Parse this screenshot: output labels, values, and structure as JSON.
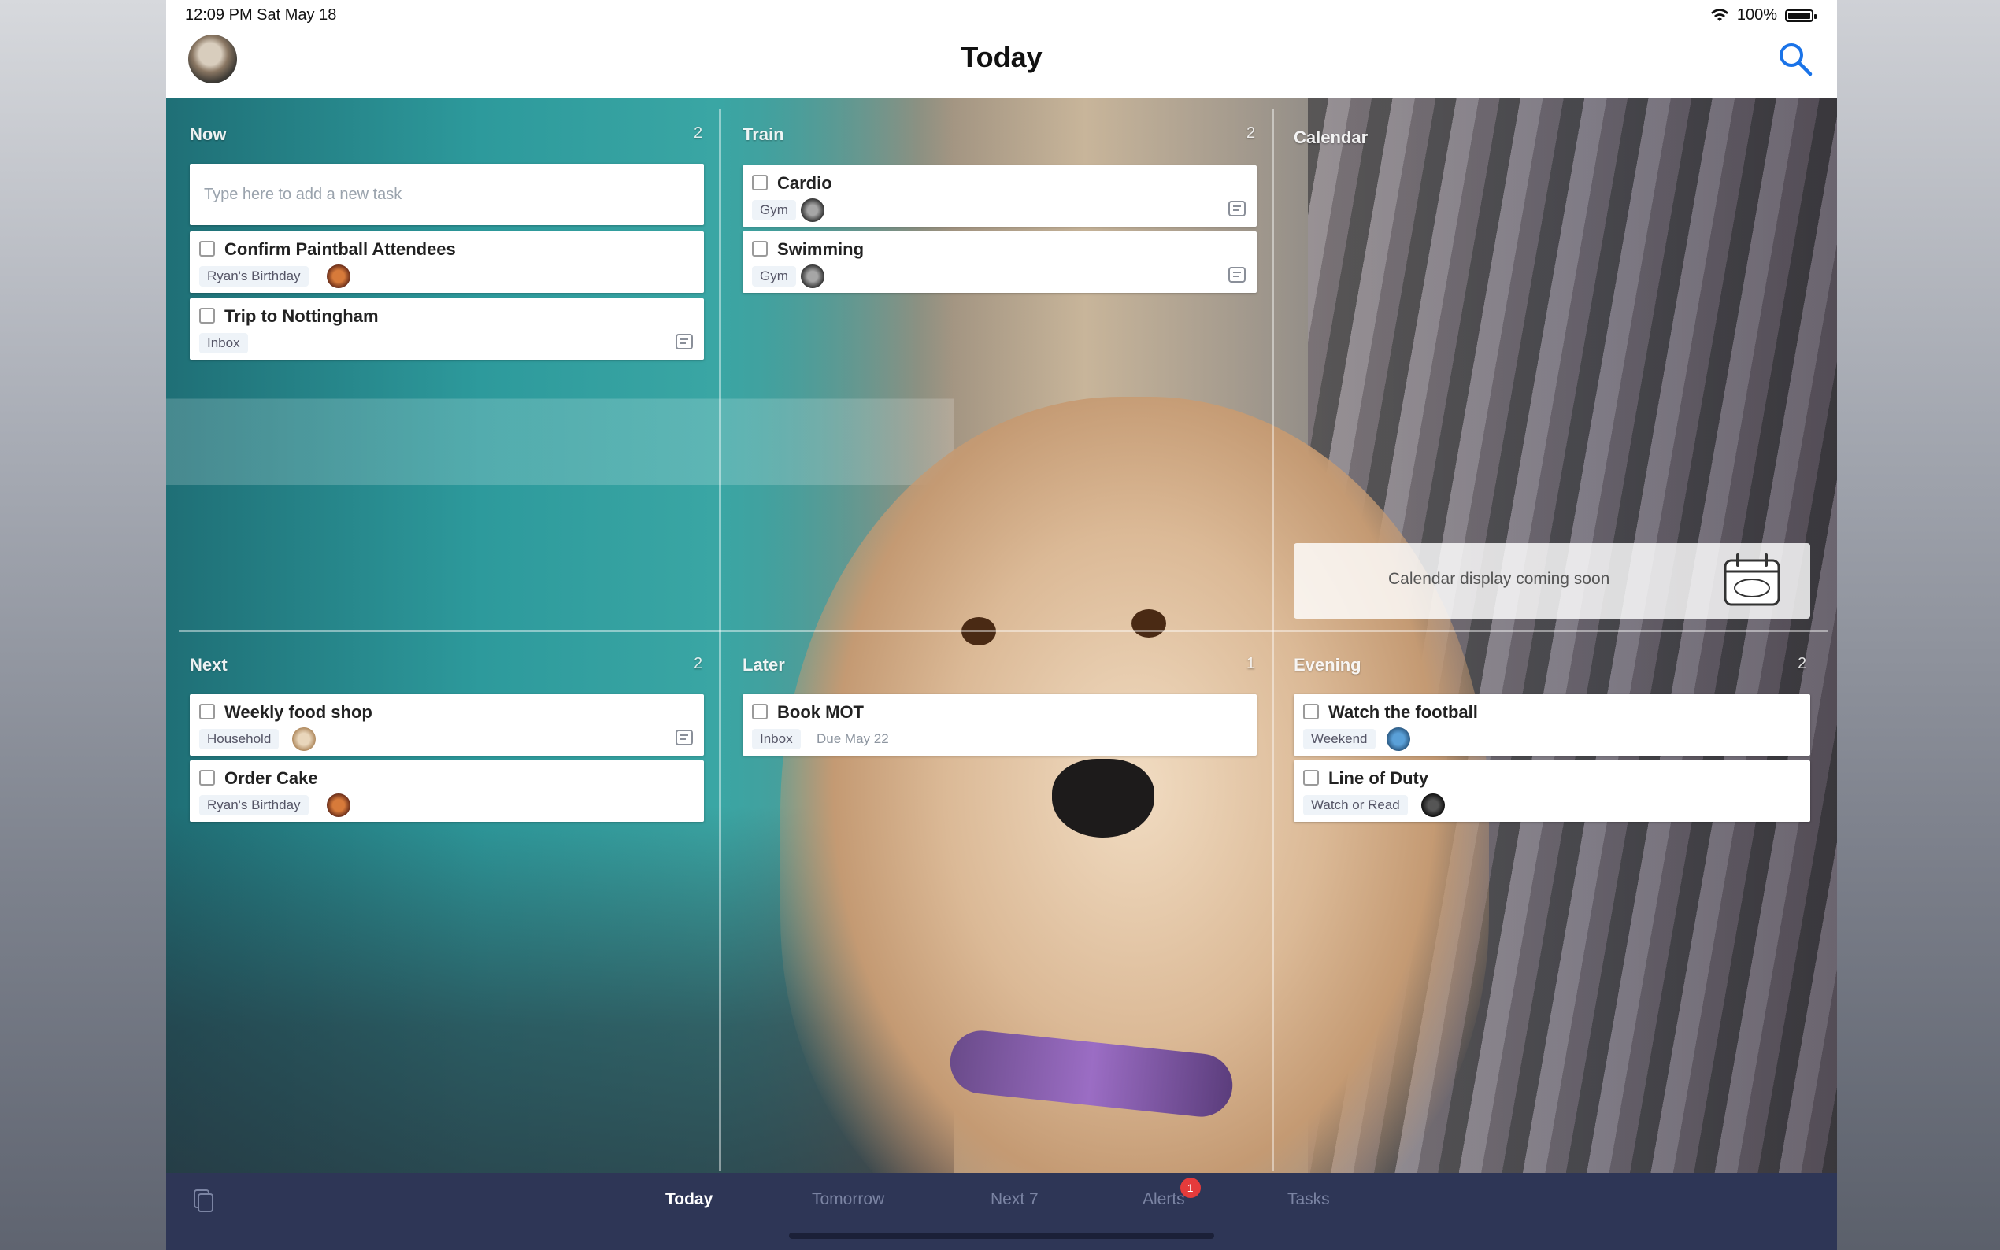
{
  "status_bar": {
    "time_date": "12:09 PM   Sat May 18",
    "battery": "100%"
  },
  "nav": {
    "title": "Today"
  },
  "sections": {
    "now": {
      "title": "Now",
      "count": "2",
      "placeholder": "Type here to add a new task",
      "tasks": [
        {
          "name": "Confirm Paintball Attendees",
          "tag": "Ryan's Birthday"
        },
        {
          "name": "Trip to Nottingham",
          "tag": "Inbox"
        }
      ]
    },
    "train": {
      "title": "Train",
      "count": "2",
      "tasks": [
        {
          "name": "Cardio",
          "tag": "Gym"
        },
        {
          "name": "Swimming",
          "tag": "Gym"
        }
      ]
    },
    "calendar": {
      "title": "Calendar",
      "message": "Calendar display coming soon"
    },
    "next": {
      "title": "Next",
      "count": "2",
      "tasks": [
        {
          "name": "Weekly food shop",
          "tag": "Household"
        },
        {
          "name": "Order Cake",
          "tag": "Ryan's Birthday"
        }
      ]
    },
    "later": {
      "title": "Later",
      "count": "1",
      "tasks": [
        {
          "name": "Book MOT",
          "tag": "Inbox",
          "due": "Due May 22"
        }
      ]
    },
    "evening": {
      "title": "Evening",
      "count": "2",
      "tasks": [
        {
          "name": "Watch the football",
          "tag": "Weekend"
        },
        {
          "name": "Line of Duty",
          "tag": "Watch or Read"
        }
      ]
    }
  },
  "tabbar": {
    "tabs": [
      "Today",
      "Tomorrow",
      "Next 7",
      "Alerts",
      "Tasks"
    ],
    "alerts_badge": "1"
  },
  "colors": {
    "tabbar_bg": "#2e3656",
    "accent_blue": "#1a73e8",
    "badge_red": "#e53b3b"
  }
}
